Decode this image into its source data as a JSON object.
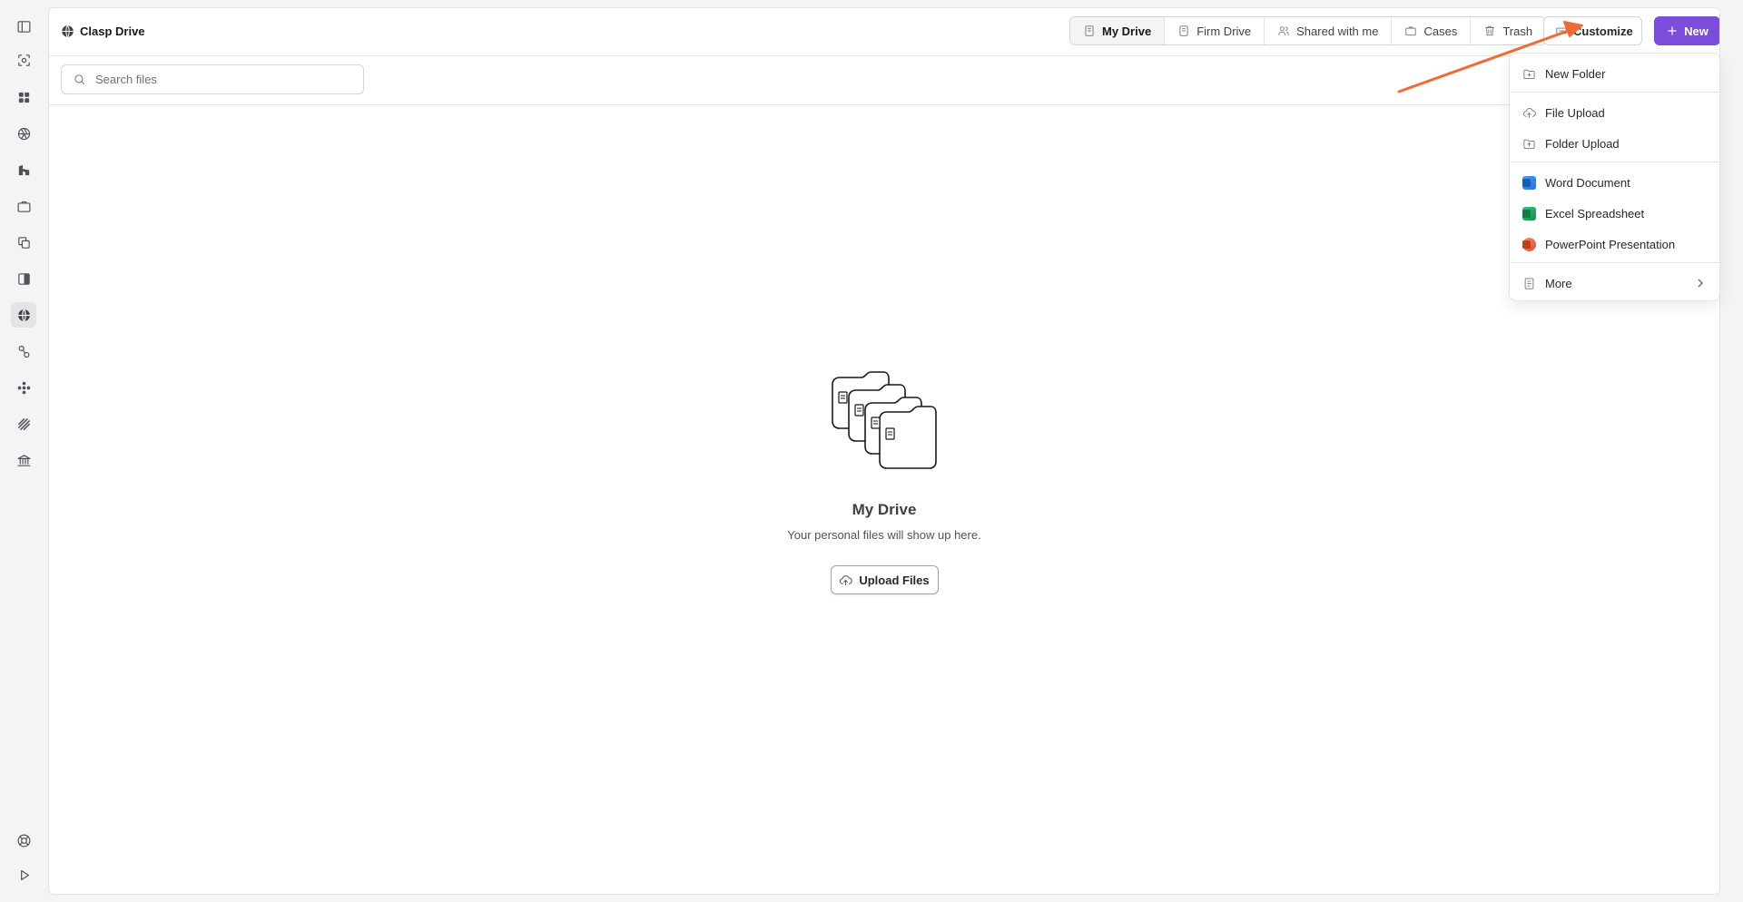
{
  "app": {
    "title": "Clasp Drive"
  },
  "tabs": [
    {
      "label": "My Drive",
      "icon": "document-icon",
      "active": true
    },
    {
      "label": "Firm Drive",
      "icon": "document-icon",
      "active": false
    },
    {
      "label": "Shared with me",
      "icon": "users-icon",
      "active": false
    },
    {
      "label": "Cases",
      "icon": "briefcase-icon",
      "active": false
    },
    {
      "label": "Trash",
      "icon": "trash-icon",
      "active": false
    }
  ],
  "toolbar": {
    "customize_label": "Customize",
    "new_label": "New"
  },
  "search": {
    "placeholder": "Search files",
    "value": ""
  },
  "empty_state": {
    "title": "My Drive",
    "subtitle": "Your personal files will show up here.",
    "button_label": "Upload Files"
  },
  "new_menu": {
    "items": [
      {
        "label": "New Folder",
        "icon": "folder-plus-icon"
      },
      {
        "label": "File Upload",
        "icon": "cloud-upload-icon"
      },
      {
        "label": "Folder Upload",
        "icon": "folder-upload-icon"
      },
      {
        "label": "Word Document",
        "icon": "word-icon"
      },
      {
        "label": "Excel Spreadsheet",
        "icon": "excel-icon"
      },
      {
        "label": "PowerPoint Presentation",
        "icon": "powerpoint-icon"
      },
      {
        "label": "More",
        "icon": "file-icon"
      }
    ]
  },
  "rail": {
    "items": [
      "sidebar-toggle-icon",
      "scan-icon",
      "grid-icon",
      "aperture-icon",
      "analytics-icon",
      "briefcase-icon",
      "copy-icon",
      "contrast-icon",
      "globe-icon",
      "link-icon",
      "apps-icon",
      "layers-icon",
      "bank-icon",
      "help-icon",
      "play-icon"
    ],
    "active": "globe-icon"
  },
  "colors": {
    "accent": "#7c4ddb",
    "annotation_arrow": "#f06a35",
    "word": "#2b6fd6",
    "excel": "#1f8a4c",
    "powerpoint": "#d9483b"
  }
}
